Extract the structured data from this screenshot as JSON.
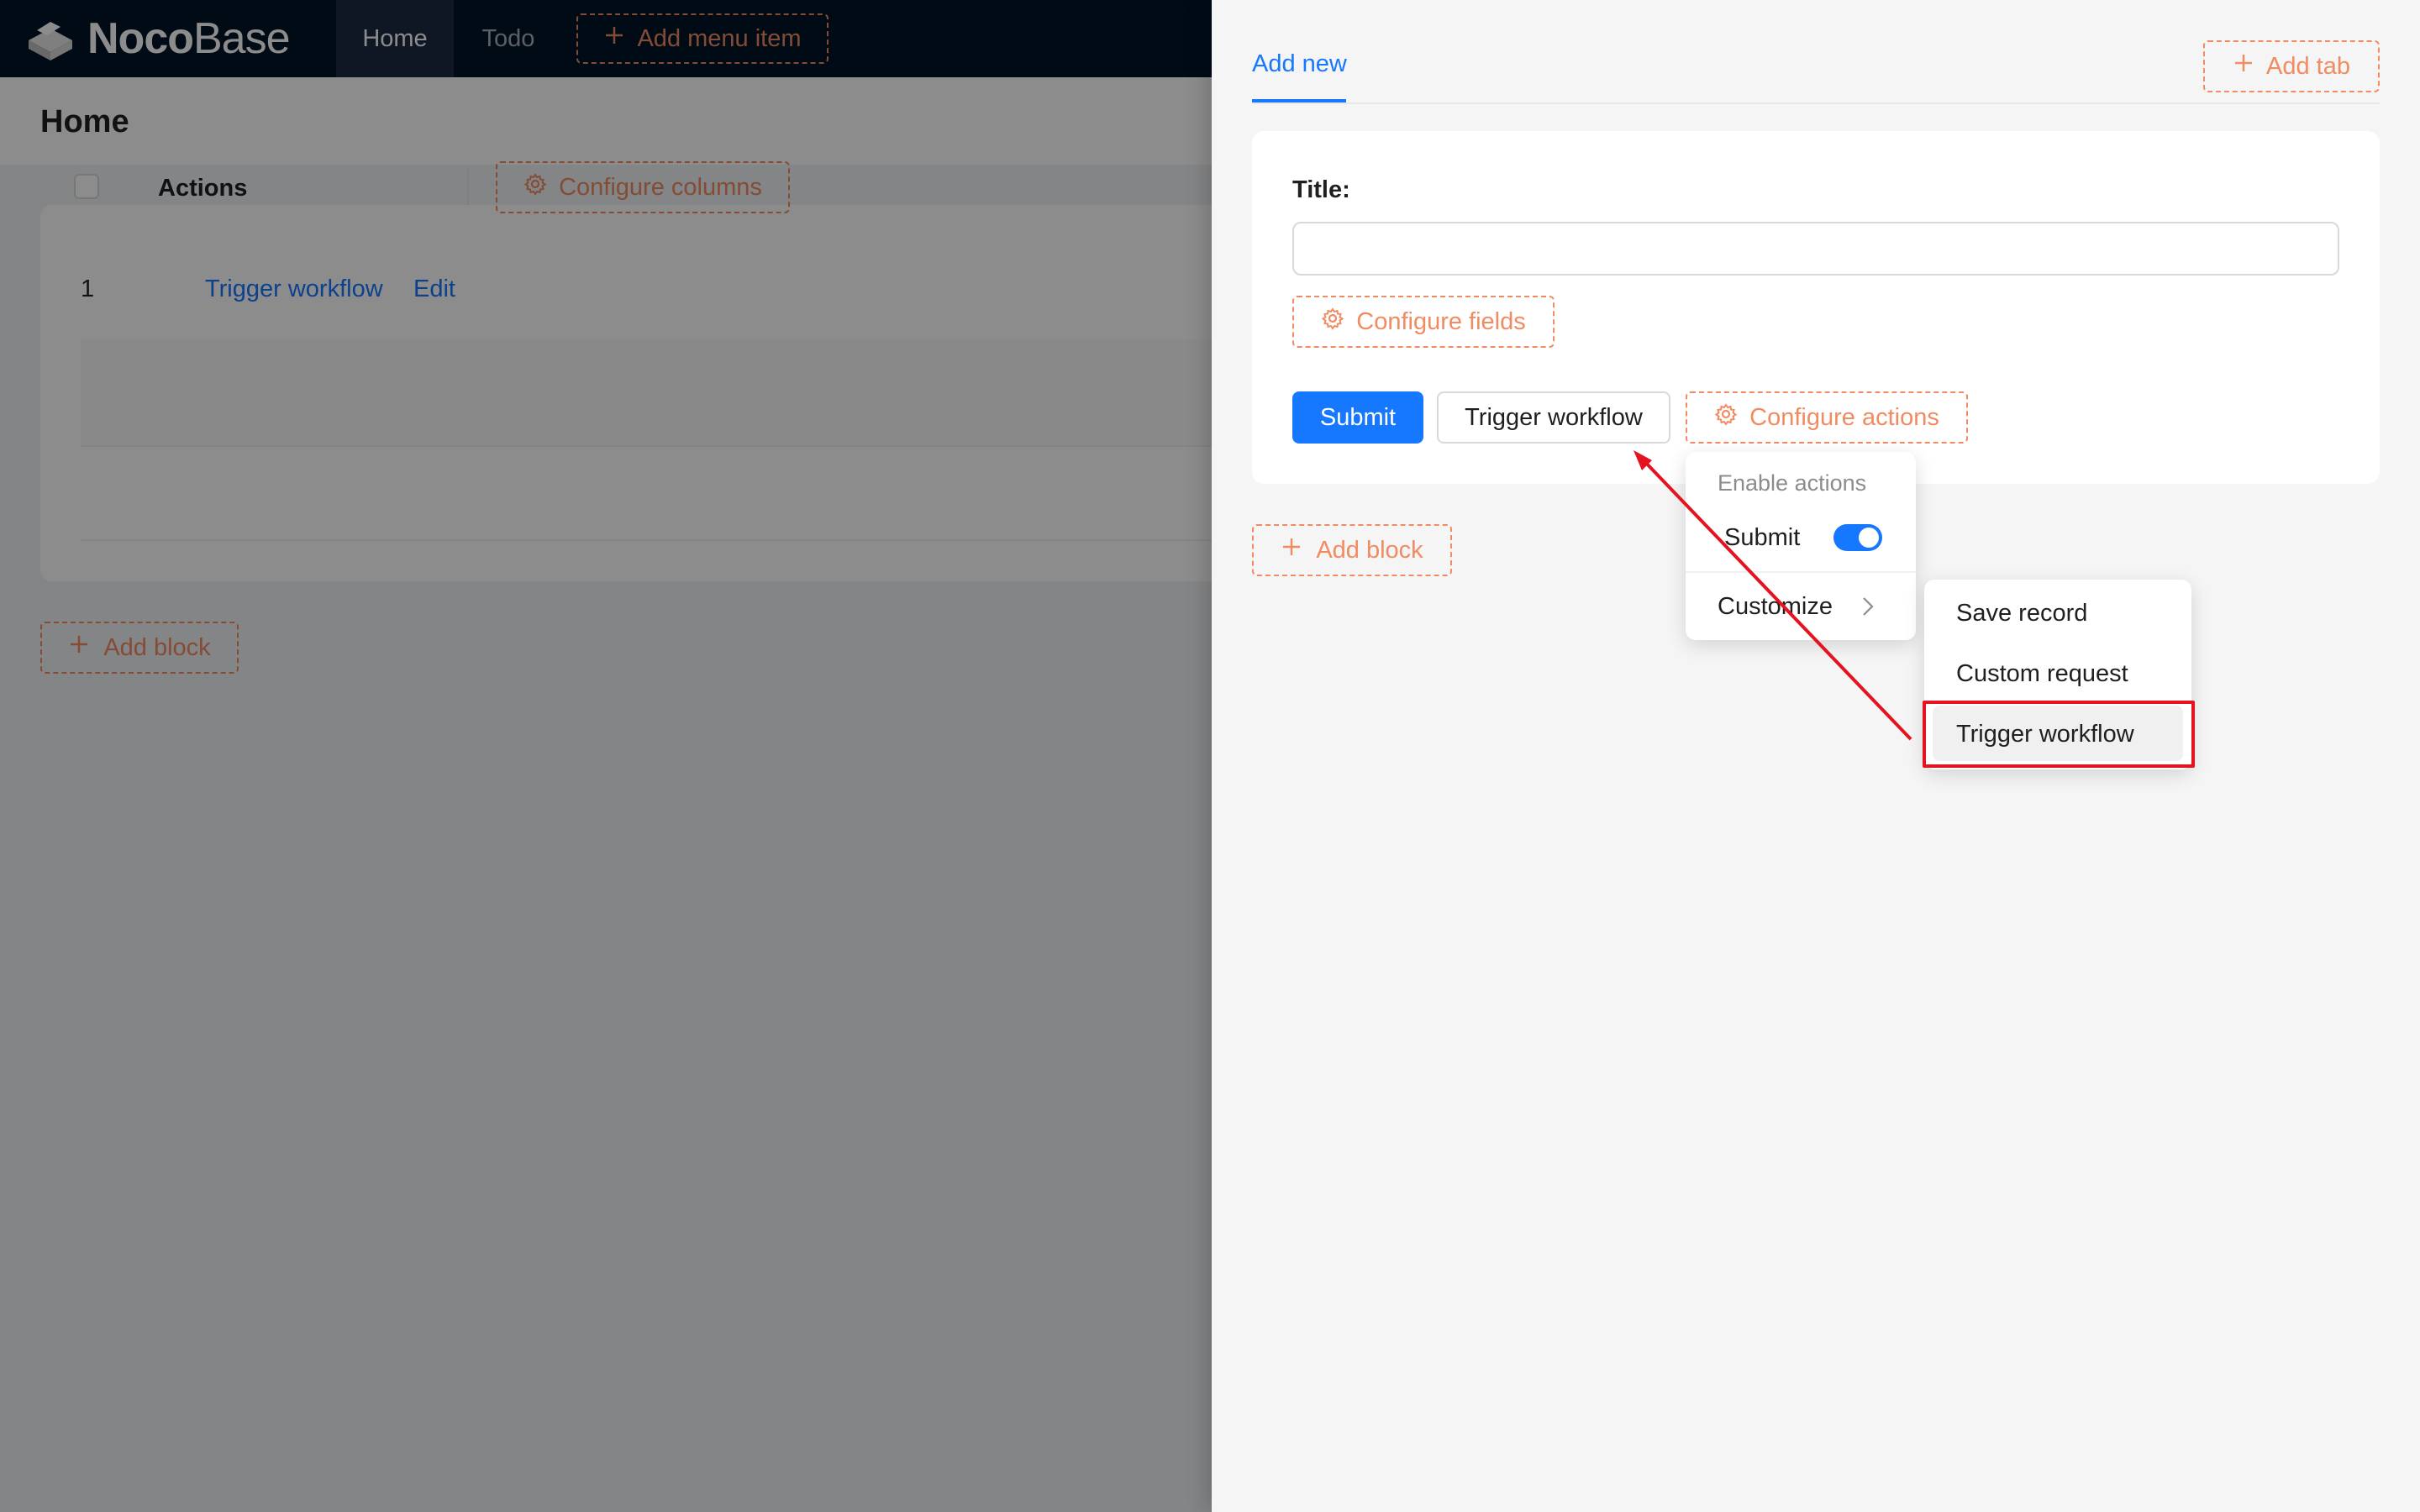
{
  "app": {
    "logo_bold": "Noco",
    "logo_light": "Base",
    "menu": [
      {
        "label": "Home"
      },
      {
        "label": "Todo"
      }
    ],
    "add_menu_item": "Add menu item"
  },
  "page": {
    "title": "Home",
    "table": {
      "actions_header": "Actions",
      "configure_columns": "Configure columns",
      "row_number": "1",
      "row_actions": [
        "Trigger workflow",
        "Edit"
      ]
    },
    "add_block": "Add block"
  },
  "drawer": {
    "tab_label": "Add new",
    "add_tab": "Add tab",
    "form": {
      "title_label": "Title",
      "title_colon": ":",
      "title_value": "",
      "configure_fields": "Configure fields",
      "submit": "Submit",
      "trigger_workflow": "Trigger workflow",
      "configure_actions": "Configure actions"
    },
    "add_block": "Add block"
  },
  "dropdown": {
    "group_title": "Enable actions",
    "submit_label": "Submit",
    "submit_enabled": true,
    "customize": "Customize"
  },
  "submenu": {
    "items": [
      "Save record",
      "Custom request",
      "Trigger workflow"
    ],
    "highlighted": "Trigger workflow"
  },
  "colors": {
    "primary": "#1677ff",
    "dashed_accent": "#f18b62",
    "annotation_red": "#e5121f",
    "header_bg": "#001529"
  }
}
